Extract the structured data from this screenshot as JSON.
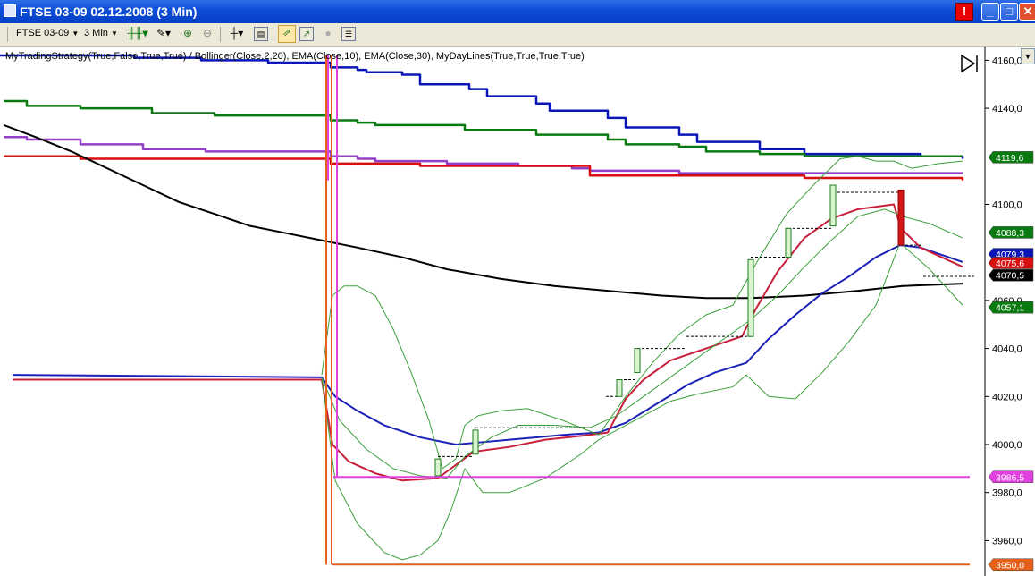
{
  "window": {
    "title": "FTSE 03-09  02.12.2008 (3 Min)",
    "buttons": {
      "minimize": "_",
      "maximize": "□",
      "close": "✕",
      "alert": "!"
    }
  },
  "toolbar": {
    "instrument": "FTSE 03-09",
    "interval": "3 Min"
  },
  "indicator_text": "MyTradingStrategy(True,False,True,True) / Bollinger(Close,2,20), EMA(Close,10), EMA(Close,30), MyDayLines(True,True,True,True)",
  "colors": {
    "blue_line": "#0b16b8",
    "green_line": "#087a10",
    "purple_line": "#9340c8",
    "red_line": "#d80f0f",
    "black_line": "#000000",
    "ema_red": "#c8203c",
    "ema_blue": "#1a22b8",
    "bollinger": "#3aa03a",
    "magenta": "#e040e0",
    "orange": "#e6601a"
  },
  "chart_data": {
    "type": "line",
    "ylim": [
      3946,
      4162
    ],
    "y_ticks": [
      {
        "value": 4160,
        "label": "4160,0"
      },
      {
        "value": 4140,
        "label": "4140,0"
      },
      {
        "value": 4100,
        "label": "4100,0"
      },
      {
        "value": 4060,
        "label": "4060,0"
      },
      {
        "value": 4040,
        "label": "4040,0"
      },
      {
        "value": 4020,
        "label": "4020,0"
      },
      {
        "value": 4000,
        "label": "4000,0"
      },
      {
        "value": 3980,
        "label": "3980,0"
      },
      {
        "value": 3960,
        "label": "3960,0"
      }
    ],
    "price_tags": [
      {
        "value": 4119.6,
        "label": "4119,6",
        "color": "#087a10"
      },
      {
        "value": 4088.3,
        "label": "4088,3",
        "color": "#087a10"
      },
      {
        "value": 4079.3,
        "label": "4079,3",
        "color": "#0b16b8"
      },
      {
        "value": 4075.6,
        "label": "4075,6",
        "color": "#d80f0f"
      },
      {
        "value": 4070.5,
        "label": "4070,5",
        "color": "#000000"
      },
      {
        "value": 4057.1,
        "label": "4057,1",
        "color": "#087a10"
      },
      {
        "value": 3986.5,
        "label": "3986,5",
        "color": "#e040e0"
      },
      {
        "value": 3950.0,
        "label": "3950,0",
        "color": "#e6601a"
      }
    ],
    "series": [
      {
        "key": "blue_line",
        "step": true,
        "width": 2.5,
        "x": [
          0,
          140,
          150,
          215,
          225,
          290,
          300,
          360,
          370,
          400,
          410,
          450,
          470,
          525,
          545,
          600,
          615,
          680,
          700,
          760,
          780,
          850,
          900,
          1030,
          1077
        ],
        "y": [
          4162,
          4162,
          4161,
          4161,
          4160,
          4160,
          4159,
          4159,
          4157,
          4156,
          4155,
          4154,
          4150,
          4148,
          4145,
          4142,
          4139,
          4136,
          4132,
          4129,
          4126,
          4123,
          4121,
          4120,
          4119
        ]
      },
      {
        "key": "green_line",
        "step": true,
        "width": 2.5,
        "x": [
          4,
          20,
          30,
          80,
          90,
          160,
          170,
          230,
          240,
          360,
          370,
          400,
          420,
          500,
          520,
          580,
          600,
          680,
          700,
          760,
          790,
          850,
          900,
          1000,
          1077
        ],
        "y": [
          4143,
          4143,
          4141,
          4141,
          4140,
          4140,
          4138,
          4138,
          4137,
          4137,
          4135,
          4134,
          4133,
          4133,
          4131,
          4131,
          4129,
          4127,
          4125,
          4124,
          4122,
          4121,
          4120,
          4120,
          4120
        ]
      },
      {
        "key": "purple_line",
        "step": true,
        "width": 2.5,
        "x": [
          4,
          20,
          30,
          80,
          90,
          150,
          160,
          220,
          230,
          360,
          370,
          400,
          420,
          480,
          500,
          560,
          580,
          640,
          660,
          740,
          760,
          850,
          900,
          1000,
          1077
        ],
        "y": [
          4128,
          4128,
          4127,
          4127,
          4125,
          4125,
          4123,
          4123,
          4122,
          4122,
          4120,
          4119,
          4118,
          4118,
          4117,
          4117,
          4116,
          4115,
          4114,
          4114,
          4113,
          4113,
          4113,
          4113,
          4113
        ]
      },
      {
        "key": "red_line",
        "step": true,
        "width": 2.5,
        "x": [
          4,
          80,
          90,
          360,
          370,
          460,
          470,
          640,
          660,
          900,
          1077
        ],
        "y": [
          4120,
          4120,
          4119,
          4119,
          4117,
          4117,
          4116,
          4116,
          4112,
          4111,
          4110
        ]
      },
      {
        "key": "black_line",
        "width": 2,
        "x": [
          4,
          40,
          80,
          120,
          160,
          200,
          240,
          280,
          320,
          360,
          400,
          450,
          500,
          560,
          620,
          680,
          740,
          790,
          840,
          900,
          960,
          1010,
          1077
        ],
        "y": [
          4133,
          4128,
          4122,
          4115,
          4108,
          4101,
          4096,
          4091,
          4088,
          4085,
          4082,
          4078,
          4073,
          4069,
          4066,
          4064,
          4062,
          4061,
          4061,
          4062,
          4064,
          4066,
          4067
        ]
      },
      {
        "key": "ema_blue",
        "width": 2,
        "x": [
          14,
          360,
          375,
          400,
          430,
          470,
          510,
          540,
          570,
          600,
          630,
          670,
          700,
          735,
          770,
          800,
          835,
          860,
          890,
          920,
          950,
          980,
          1007,
          1030,
          1077
        ],
        "y": [
          4029,
          4028,
          4020,
          4014,
          4008,
          4003,
          4000,
          4001,
          4002,
          4003,
          4004,
          4005,
          4009,
          4017,
          4025,
          4030,
          4034,
          4044,
          4054,
          4063,
          4070,
          4078,
          4083,
          4082,
          4076
        ]
      },
      {
        "key": "ema_red",
        "width": 2,
        "x": [
          14,
          360,
          372,
          390,
          420,
          450,
          490,
          530,
          570,
          610,
          660,
          680,
          700,
          720,
          750,
          790,
          830,
          845,
          870,
          900,
          930,
          960,
          1000,
          1008,
          1030,
          1077
        ],
        "y": [
          4027,
          4027,
          4000,
          3993,
          3988,
          3985,
          3986,
          3997,
          3999,
          4002,
          4004,
          4005,
          4019,
          4027,
          4035,
          4040,
          4045,
          4056,
          4072,
          4086,
          4094,
          4098,
          4100,
          4090,
          4082,
          4074
        ]
      },
      {
        "key": "bollinger",
        "width": 1,
        "x": [
          360,
          372,
          385,
          400,
          420,
          440,
          460,
          480,
          495,
          510,
          520,
          535,
          560,
          590,
          630,
          670,
          700,
          730,
          760,
          790,
          820,
          850,
          880,
          910,
          940,
          960,
          980,
          1000,
          1020,
          1050,
          1077
        ],
        "y": [
          4029,
          4062,
          4066,
          4066,
          4062,
          4048,
          4030,
          4010,
          3990,
          3994,
          4008,
          4012,
          4014,
          4015,
          4010,
          4004,
          4020,
          4034,
          4046,
          4054,
          4058,
          4078,
          4096,
          4108,
          4119,
          4120,
          4118,
          4118,
          4115,
          4117,
          4118
        ]
      },
      {
        "key": "bollinger",
        "width": 1,
        "x": [
          360,
          375,
          400,
          430,
          450,
          470,
          490,
          505,
          520,
          540,
          570,
          610,
          650,
          670,
          700,
          730,
          750,
          780,
          820,
          835,
          860,
          890,
          920,
          950,
          980,
          1007,
          1040,
          1077
        ],
        "y": [
          4028,
          3985,
          3967,
          3955,
          3952,
          3954,
          3960,
          3973,
          3990,
          3980,
          3980,
          3986,
          3996,
          4002,
          4008,
          4014,
          4018,
          4021,
          4024,
          4029,
          4020,
          4019,
          4030,
          4043,
          4058,
          4084,
          4073,
          4058
        ]
      },
      {
        "key": "bollinger",
        "width": 1,
        "x": [
          360,
          380,
          410,
          440,
          470,
          500,
          520,
          550,
          580,
          620,
          660,
          690,
          720,
          750,
          780,
          810,
          840,
          870,
          900,
          930,
          960,
          990,
          1010,
          1040,
          1077
        ],
        "y": [
          4028,
          4010,
          3998,
          3990,
          3987,
          3986,
          3995,
          4003,
          4008,
          4008,
          4007,
          4012,
          4020,
          4028,
          4036,
          4044,
          4052,
          4062,
          4074,
          4085,
          4095,
          4098,
          4095,
          4092,
          4086
        ]
      }
    ],
    "level_lines": [
      {
        "key": "magenta",
        "value": 3986.5,
        "x_from": 373,
        "x_to": 1085
      },
      {
        "key": "orange",
        "value": 3950.0,
        "x_from": 372,
        "x_to": 1085
      }
    ],
    "vertical_lines": [
      {
        "key": "orange",
        "x": 365,
        "from": 4162,
        "to": 3950
      },
      {
        "key": "orange",
        "x": 371,
        "from": 4162,
        "to": 3950
      },
      {
        "key": "magenta",
        "x": 367,
        "from": 4162,
        "to": 4110
      },
      {
        "key": "magenta",
        "x": 377,
        "from": 4162,
        "to": 3986.5
      }
    ],
    "bars": [
      {
        "x": 490,
        "open": 3987,
        "close": 3994,
        "color": "green"
      },
      {
        "x": 532,
        "open": 3996,
        "close": 4006,
        "color": "green"
      },
      {
        "x": 693,
        "open": 4020,
        "close": 4027,
        "color": "green"
      },
      {
        "x": 713,
        "open": 4030,
        "close": 4040,
        "color": "green"
      },
      {
        "x": 840,
        "open": 4045,
        "close": 4077,
        "color": "green"
      },
      {
        "x": 882,
        "open": 4078,
        "close": 4090,
        "color": "green"
      },
      {
        "x": 932,
        "open": 4091,
        "close": 4108,
        "color": "green"
      },
      {
        "x": 1008,
        "open": 4106,
        "close": 4083,
        "color": "red"
      }
    ],
    "dashed_stops": [
      {
        "x1": 490,
        "x2": 530,
        "y": 3995
      },
      {
        "x1": 532,
        "x2": 660,
        "y": 4007
      },
      {
        "x1": 678,
        "x2": 693,
        "y": 4020
      },
      {
        "x1": 693,
        "x2": 713,
        "y": 4027
      },
      {
        "x1": 713,
        "x2": 768,
        "y": 4040
      },
      {
        "x1": 768,
        "x2": 840,
        "y": 4045
      },
      {
        "x1": 840,
        "x2": 882,
        "y": 4078
      },
      {
        "x1": 882,
        "x2": 932,
        "y": 4090
      },
      {
        "x1": 932,
        "x2": 1008,
        "y": 4105
      },
      {
        "x1": 1008,
        "x2": 1032,
        "y": 4083
      },
      {
        "x1": 1033,
        "x2": 1090,
        "y": 4070
      }
    ]
  }
}
